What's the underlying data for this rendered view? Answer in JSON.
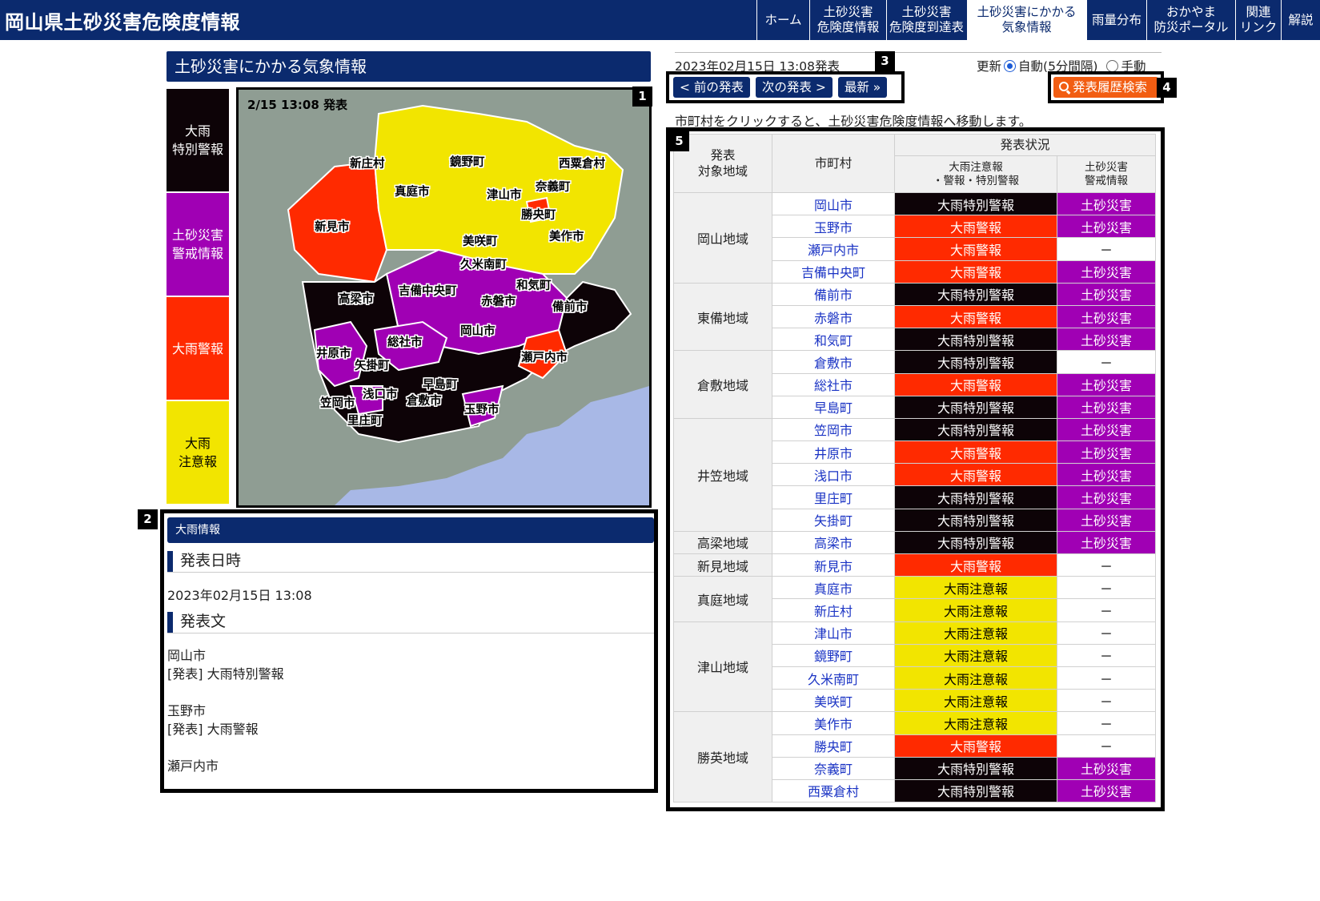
{
  "header": {
    "site_title": "岡山県土砂災害危険度情報",
    "nav": [
      {
        "label": "ホーム"
      },
      {
        "label": "土砂災害\n危険度情報"
      },
      {
        "label": "土砂災害\n危険度到達表"
      },
      {
        "label": "土砂災害にかかる\n気象情報",
        "active": true
      },
      {
        "label": "雨量分布"
      },
      {
        "label": "おかやま\n防災ポータル"
      },
      {
        "label": "関連\nリンク"
      },
      {
        "label": "解説"
      }
    ]
  },
  "left": {
    "heading": "土砂災害にかかる気象情報",
    "legend": [
      {
        "label": "大雨\n特別警報",
        "color": "#0d0307",
        "text_color": "#ffffff"
      },
      {
        "label": "土砂災害\n警戒情報",
        "color": "#a000b4",
        "text_color": "#ffffff"
      },
      {
        "label": "大雨警報",
        "color": "#ff2a00",
        "text_color": "#ffffff"
      },
      {
        "label": "大雨\n注意報",
        "color": "#f2e500",
        "text_color": "#000000"
      }
    ],
    "map": {
      "timestamp": "2/15 13:08 発表",
      "labels": [
        "新庄村",
        "鏡野町",
        "西粟倉村",
        "真庭市",
        "津山市",
        "奈義町",
        "新見市",
        "勝央町",
        "美作市",
        "美咲町",
        "久米南町",
        "高梁市",
        "吉備中央町",
        "和気町",
        "赤磐市",
        "備前市",
        "岡山市",
        "総社市",
        "井原市",
        "矢掛町",
        "瀬戸内市",
        "早島町",
        "笠岡市",
        "浅口市",
        "倉敷市",
        "玉野市",
        "里庄町"
      ]
    },
    "info": {
      "header": "大雨情報",
      "date_heading": "発表日時",
      "date_value": "2023年02月15日 13:08",
      "text_heading": "発表文",
      "text_body": "岡山市\n[発表] 大雨特別警報\n\n玉野市\n[発表] 大雨警報\n\n瀬戸内市"
    }
  },
  "right": {
    "pub_date": "2023年02月15日 13:08発表",
    "update_label": "更新",
    "auto_label": "自動(5分間隔)",
    "manual_label": "手動",
    "prev_button": "< 前の発表",
    "next_button": "次の発表 >",
    "latest_button": "最新 »",
    "history_button": "発表履歴検索",
    "hint": "市町村をクリックすると、土砂災害危険度情報へ移動します。",
    "table": {
      "col_area": "発表\n対象地域",
      "col_city": "市町村",
      "col_status": "発表状況",
      "col_rain": "大雨注意報\n・警報・特別警報",
      "col_dosha": "土砂災害\n警戒情報",
      "levels": {
        "special": "大雨特別警報",
        "warning": "大雨警報",
        "advisory": "大雨注意報",
        "dosha": "土砂災害",
        "none": "－"
      },
      "regions": [
        {
          "name": "岡山地域",
          "rows": [
            {
              "city": "岡山市",
              "rain": "special",
              "dosha": true
            },
            {
              "city": "玉野市",
              "rain": "warning",
              "dosha": true
            },
            {
              "city": "瀬戸内市",
              "rain": "warning",
              "dosha": false
            },
            {
              "city": "吉備中央町",
              "rain": "warning",
              "dosha": true
            }
          ]
        },
        {
          "name": "東備地域",
          "rows": [
            {
              "city": "備前市",
              "rain": "special",
              "dosha": true
            },
            {
              "city": "赤磐市",
              "rain": "warning",
              "dosha": true
            },
            {
              "city": "和気町",
              "rain": "special",
              "dosha": true
            }
          ]
        },
        {
          "name": "倉敷地域",
          "rows": [
            {
              "city": "倉敷市",
              "rain": "special",
              "dosha": false
            },
            {
              "city": "総社市",
              "rain": "warning",
              "dosha": true
            },
            {
              "city": "早島町",
              "rain": "special",
              "dosha": true
            }
          ]
        },
        {
          "name": "井笠地域",
          "rows": [
            {
              "city": "笠岡市",
              "rain": "special",
              "dosha": true
            },
            {
              "city": "井原市",
              "rain": "warning",
              "dosha": true
            },
            {
              "city": "浅口市",
              "rain": "warning",
              "dosha": true
            },
            {
              "city": "里庄町",
              "rain": "special",
              "dosha": true
            },
            {
              "city": "矢掛町",
              "rain": "special",
              "dosha": true
            }
          ]
        },
        {
          "name": "高梁地域",
          "rows": [
            {
              "city": "高梁市",
              "rain": "special",
              "dosha": true
            }
          ]
        },
        {
          "name": "新見地域",
          "rows": [
            {
              "city": "新見市",
              "rain": "warning",
              "dosha": false
            }
          ]
        },
        {
          "name": "真庭地域",
          "rows": [
            {
              "city": "真庭市",
              "rain": "advisory",
              "dosha": false
            },
            {
              "city": "新庄村",
              "rain": "advisory",
              "dosha": false
            }
          ]
        },
        {
          "name": "津山地域",
          "rows": [
            {
              "city": "津山市",
              "rain": "advisory",
              "dosha": false
            },
            {
              "city": "鏡野町",
              "rain": "advisory",
              "dosha": false
            },
            {
              "city": "久米南町",
              "rain": "advisory",
              "dosha": false
            },
            {
              "city": "美咲町",
              "rain": "advisory",
              "dosha": false
            }
          ]
        },
        {
          "name": "勝英地域",
          "rows": [
            {
              "city": "美作市",
              "rain": "advisory",
              "dosha": false
            },
            {
              "city": "勝央町",
              "rain": "warning",
              "dosha": false
            },
            {
              "city": "奈義町",
              "rain": "special",
              "dosha": true
            },
            {
              "city": "西粟倉村",
              "rain": "special",
              "dosha": true
            }
          ]
        }
      ]
    }
  },
  "callouts": [
    "1",
    "2",
    "3",
    "4",
    "5"
  ]
}
